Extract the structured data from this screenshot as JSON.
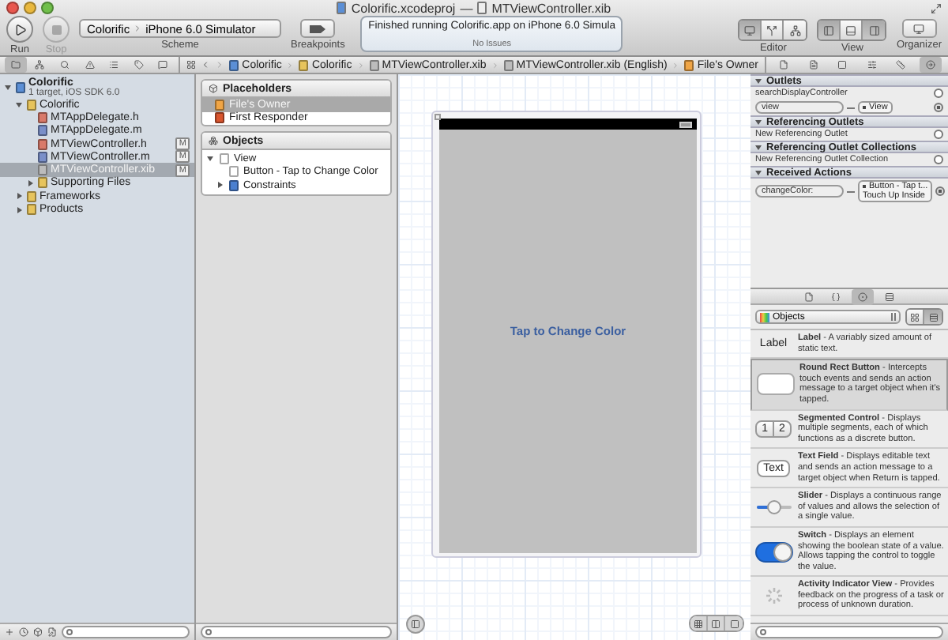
{
  "window": {
    "title_project": "Colorific.xcodeproj",
    "title_separator": "—",
    "title_file": "MTViewController.xib"
  },
  "toolbar": {
    "run": {
      "label": "Run",
      "disabled": false
    },
    "stop": {
      "label": "Stop",
      "disabled": true
    },
    "scheme": {
      "project": "Colorific",
      "device": "iPhone 6.0 Simulator",
      "label": "Scheme"
    },
    "breakpoints": {
      "label": "Breakpoints"
    },
    "activity": {
      "message": "Finished running Colorific.app on iPhone 6.0 Simula",
      "status": "No Issues"
    },
    "editor": {
      "label": "Editor",
      "segments": [
        {
          "selected": true
        },
        {
          "selected": false
        },
        {
          "selected": false
        }
      ]
    },
    "view": {
      "label": "View",
      "segments": [
        {
          "selected": true
        },
        {
          "selected": false
        },
        {
          "selected": true
        }
      ]
    },
    "organizer": {
      "label": "Organizer"
    }
  },
  "navigator": {
    "tabs": [
      {
        "selected": true
      },
      {
        "selected": false
      },
      {
        "selected": false
      },
      {
        "selected": false
      },
      {
        "selected": false
      },
      {
        "selected": false
      },
      {
        "selected": false
      }
    ],
    "tree": [
      {
        "name": "Colorific",
        "subtitle": "1 target, iOS SDK 6.0",
        "kind": "project",
        "expanded": true,
        "selected": false,
        "children": [
          {
            "name": "Colorific",
            "kind": "folder",
            "expanded": true,
            "selected": false,
            "children": [
              {
                "name": "MTAppDelegate.h",
                "kind": "header",
                "selected": false
              },
              {
                "name": "MTAppDelegate.m",
                "kind": "source",
                "selected": false
              },
              {
                "name": "MTViewController.h",
                "kind": "header",
                "selected": false,
                "badge": "M"
              },
              {
                "name": "MTViewController.m",
                "kind": "source",
                "selected": false,
                "badge": "M"
              },
              {
                "name": "MTViewController.xib",
                "kind": "xib",
                "selected": true,
                "badge": "M"
              },
              {
                "name": "Supporting Files",
                "kind": "folder",
                "expanded": false,
                "selected": false
              }
            ]
          },
          {
            "name": "Frameworks",
            "kind": "folder",
            "expanded": false,
            "selected": false
          },
          {
            "name": "Products",
            "kind": "folder",
            "expanded": false,
            "selected": false
          }
        ]
      }
    ]
  },
  "jump_bar": [
    {
      "label": "Colorific",
      "kind": "project"
    },
    {
      "label": "Colorific",
      "kind": "folder"
    },
    {
      "label": "MTViewController.xib",
      "kind": "xib"
    },
    {
      "label": "MTViewController.xib (English)",
      "kind": "xib"
    },
    {
      "label": "File's Owner",
      "kind": "placeholder"
    }
  ],
  "outline": {
    "placeholders": {
      "title": "Placeholders",
      "items": [
        {
          "label": "File's Owner",
          "kind": "owner",
          "selected": true
        },
        {
          "label": "First Responder",
          "kind": "responder",
          "selected": false
        }
      ]
    },
    "objects": {
      "title": "Objects",
      "tree": [
        {
          "label": "View",
          "kind": "view",
          "expanded": true,
          "children": [
            {
              "label": "Button - Tap to Change Color",
              "kind": "button"
            },
            {
              "label": "Constraints",
              "kind": "constraints",
              "expanded": false
            }
          ]
        }
      ]
    }
  },
  "canvas": {
    "button_title": "Tap to Change Color"
  },
  "inspector": {
    "tabs": [
      {
        "selected": false
      },
      {
        "selected": false
      },
      {
        "selected": false
      },
      {
        "selected": false
      },
      {
        "selected": false
      },
      {
        "selected": true
      }
    ],
    "sections": [
      {
        "title": "Outlets",
        "expanded": true,
        "rows": [
          {
            "label": "searchDisplayController",
            "connected": false
          },
          {
            "label": "view",
            "target": "View",
            "connected": true
          }
        ]
      },
      {
        "title": "Referencing Outlets",
        "expanded": true,
        "rows": [
          {
            "label": "New Referencing Outlet",
            "connected": false
          }
        ]
      },
      {
        "title": "Referencing Outlet Collections",
        "expanded": true,
        "rows": [
          {
            "label": "New Referencing Outlet Collection",
            "connected": false
          }
        ]
      },
      {
        "title": "Received Actions",
        "expanded": true,
        "rows": [
          {
            "label": "changeColor:",
            "target": "Button - Tap t...",
            "event": "Touch Up Inside",
            "connected": true
          }
        ]
      }
    ]
  },
  "library": {
    "tabs": [
      {
        "selected": false
      },
      {
        "selected": false
      },
      {
        "selected": true
      },
      {
        "selected": false
      }
    ],
    "category": "Objects",
    "layouts": [
      {
        "selected": false
      },
      {
        "selected": true
      }
    ],
    "items": [
      {
        "kind": "label",
        "preview": "Label",
        "description": "**Label** - A variably sized amount of static text.",
        "selected": false
      },
      {
        "kind": "button",
        "description": "**Round Rect Button** - Intercepts touch events and sends an action message to a target object when it's tapped.",
        "selected": true
      },
      {
        "kind": "segmented",
        "preview_segments": [
          "1",
          "2"
        ],
        "description": "**Segmented Control** - Displays multiple segments, each of which functions as a discrete button.",
        "selected": false
      },
      {
        "kind": "textfield",
        "preview": "Text",
        "description": "**Text Field** - Displays editable text and sends an action message to a target object when Return is tapped.",
        "selected": false
      },
      {
        "kind": "slider",
        "description": "**Slider** - Displays a continuous range of values and allows the selection of a single value.",
        "selected": false
      },
      {
        "kind": "switch",
        "description": "**Switch** - Displays an element showing the boolean state of a value. Allows tapping the control to toggle the value.",
        "selected": false
      },
      {
        "kind": "activity",
        "description": "**Activity Indicator View** - Provides feedback on the progress of a task or process of unknown duration.",
        "selected": false
      }
    ]
  }
}
